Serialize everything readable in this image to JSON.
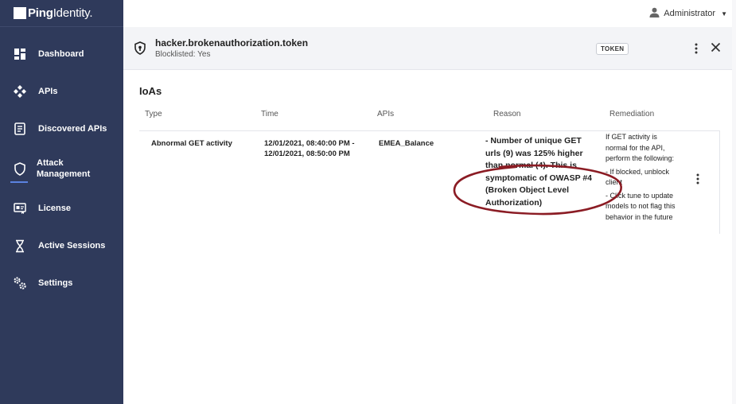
{
  "brand": {
    "name_bold": "Ping",
    "name_rest": "Identity."
  },
  "header": {
    "user_name": "Administrator"
  },
  "sidebar": {
    "items": [
      {
        "label": "Dashboard",
        "icon": "dashboard-icon"
      },
      {
        "label": "APIs",
        "icon": "apis-icon"
      },
      {
        "label": "Discovered APIs",
        "icon": "discovered-apis-icon"
      },
      {
        "label": "Attack Management",
        "icon": "shield-icon",
        "active": true
      },
      {
        "label": "License",
        "icon": "license-icon"
      },
      {
        "label": "Active Sessions",
        "icon": "hourglass-icon"
      },
      {
        "label": "Settings",
        "icon": "settings-icon"
      }
    ]
  },
  "token": {
    "name": "hacker.brokenauthorization.token",
    "status": "Blocklisted: Yes",
    "badge": "TOKEN"
  },
  "ioas": {
    "title": "IoAs",
    "columns": [
      "Type",
      "Time",
      "APIs",
      "Reason",
      "Remediation"
    ],
    "rows": [
      {
        "type": "Abnormal GET activity",
        "time_line1": "12/01/2021, 08:40:00 PM -",
        "time_line2": "12/01/2021, 08:50:00 PM",
        "api": "EMEA_Balance",
        "reason_lines": [
          "- Number of unique GET",
          "urls (9) was 125% higher",
          "than normal (4). This is",
          "symptomatic of OWASP #4",
          "(Broken Object Level",
          "Authorization)"
        ],
        "remediation_lines": [
          "If GET activity is",
          "normal for the API,",
          "perform the following:",
          "- If blocked, unblock",
          "client",
          "- Click tune to update",
          "models to not flag this",
          "behavior in the future"
        ]
      }
    ]
  },
  "colors": {
    "sidebar_bg": "#2f3a5b",
    "panel_header_bg": "#f3f4f7",
    "active_underline": "#5b82e0",
    "annotation_oval": "#8b1c24"
  }
}
